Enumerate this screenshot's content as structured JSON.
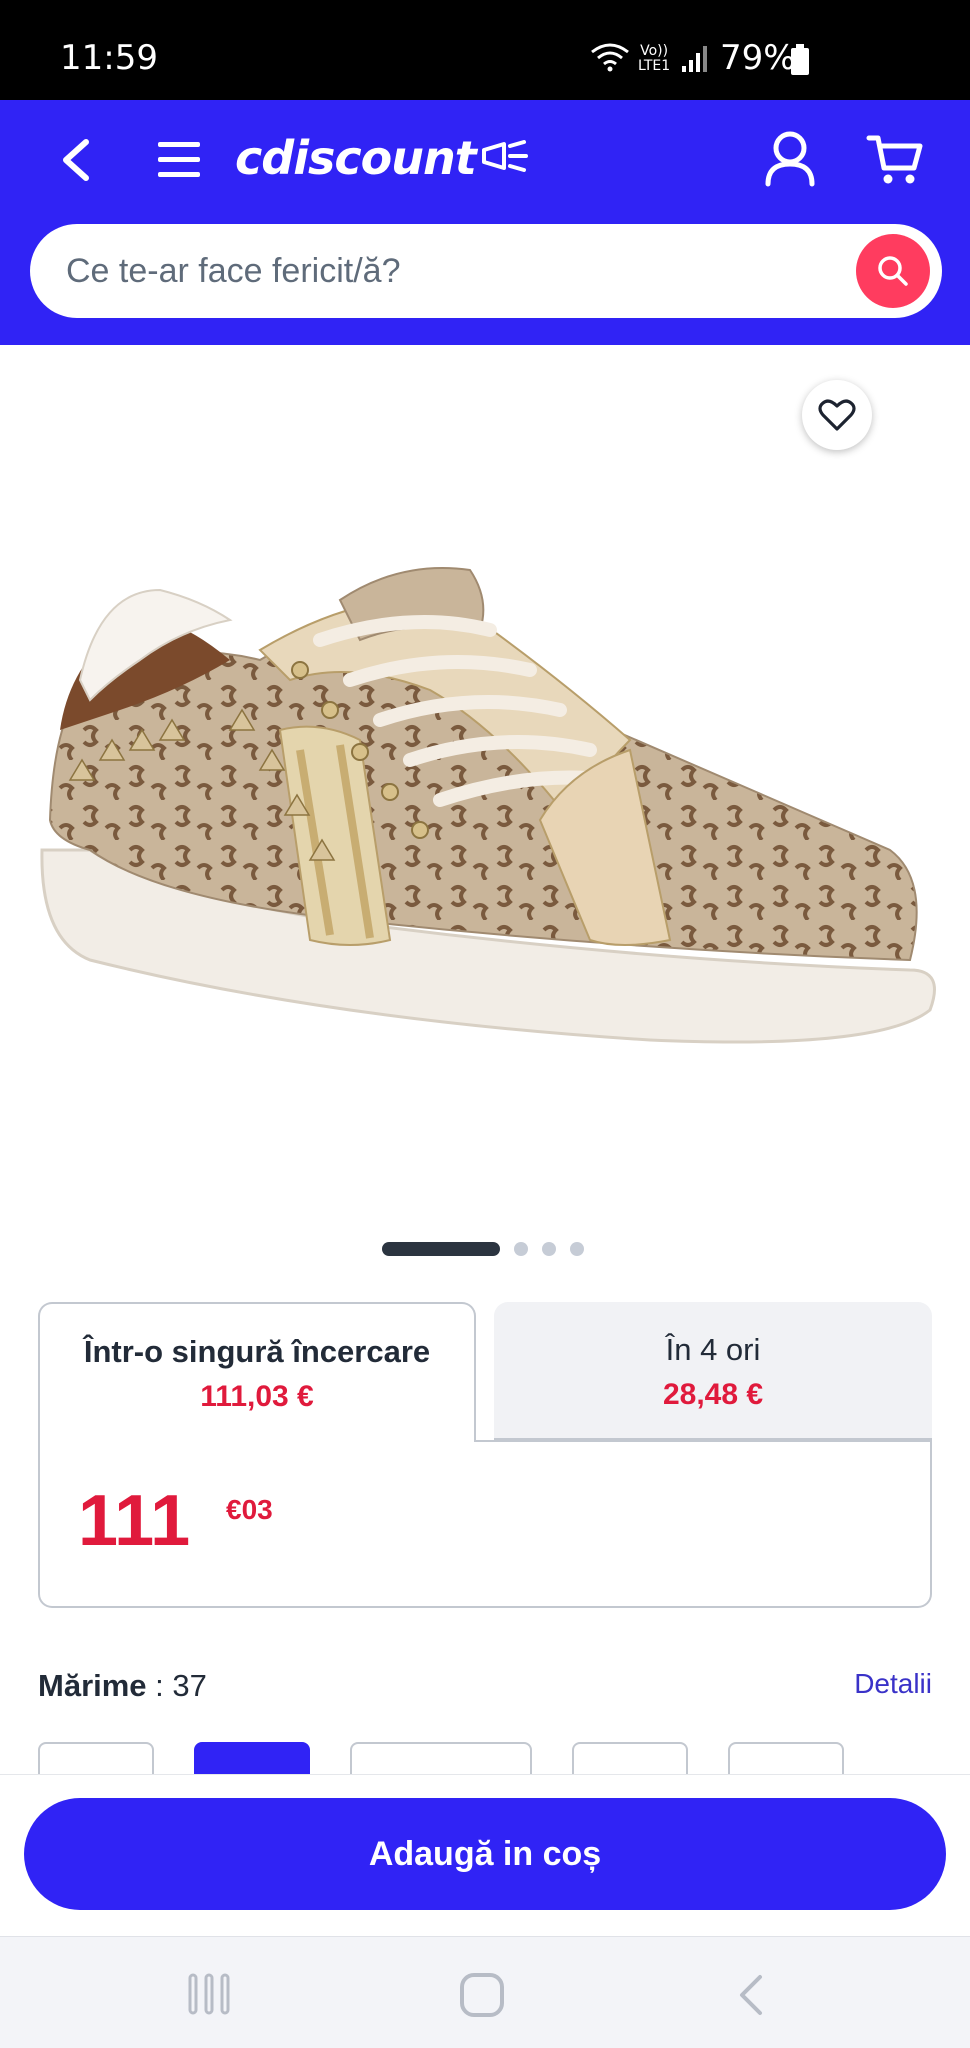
{
  "status_bar": {
    "time": "11:59",
    "battery": "79%",
    "network": "LTE1"
  },
  "header": {
    "logo_text": "cdiscount",
    "search": {
      "placeholder": "Ce te-ar face fericit/ă?"
    }
  },
  "gallery": {
    "image_count": 4,
    "active_index": 0
  },
  "payment_tabs": [
    {
      "title": "Într-o singură încercare",
      "price": "111,03 €",
      "selected": true
    },
    {
      "title": "În 4 ori",
      "price": "28,48 €",
      "selected": false
    }
  ],
  "price": {
    "main": "111",
    "cents": "€03"
  },
  "size": {
    "label": "Mărime",
    "separator": " : ",
    "value": "37",
    "details_label": "Detalii"
  },
  "cta": {
    "add_to_cart": "Adaugă in coș"
  },
  "colors": {
    "brand": "#3023f5",
    "price": "#e01a3c",
    "search_button": "#ff3c5f"
  }
}
